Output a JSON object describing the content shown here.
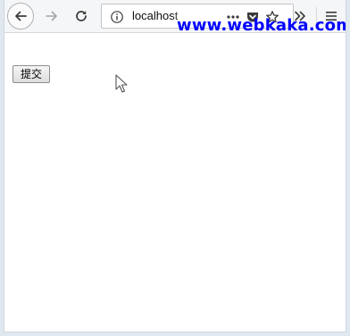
{
  "browser": {
    "url": "localhost",
    "icons": {
      "back": "back-arrow-icon",
      "forward": "forward-arrow-icon",
      "reload": "reload-icon",
      "info": "info-icon",
      "page_actions": "more-dots-icon",
      "pocket": "pocket-icon",
      "bookmark": "star-icon",
      "overflow": "double-chevron-icon",
      "menu": "hamburger-menu-icon"
    }
  },
  "watermark": {
    "text": "www.webkaka.com",
    "color": "#0000ff"
  },
  "page": {
    "submit_label": "提交"
  }
}
